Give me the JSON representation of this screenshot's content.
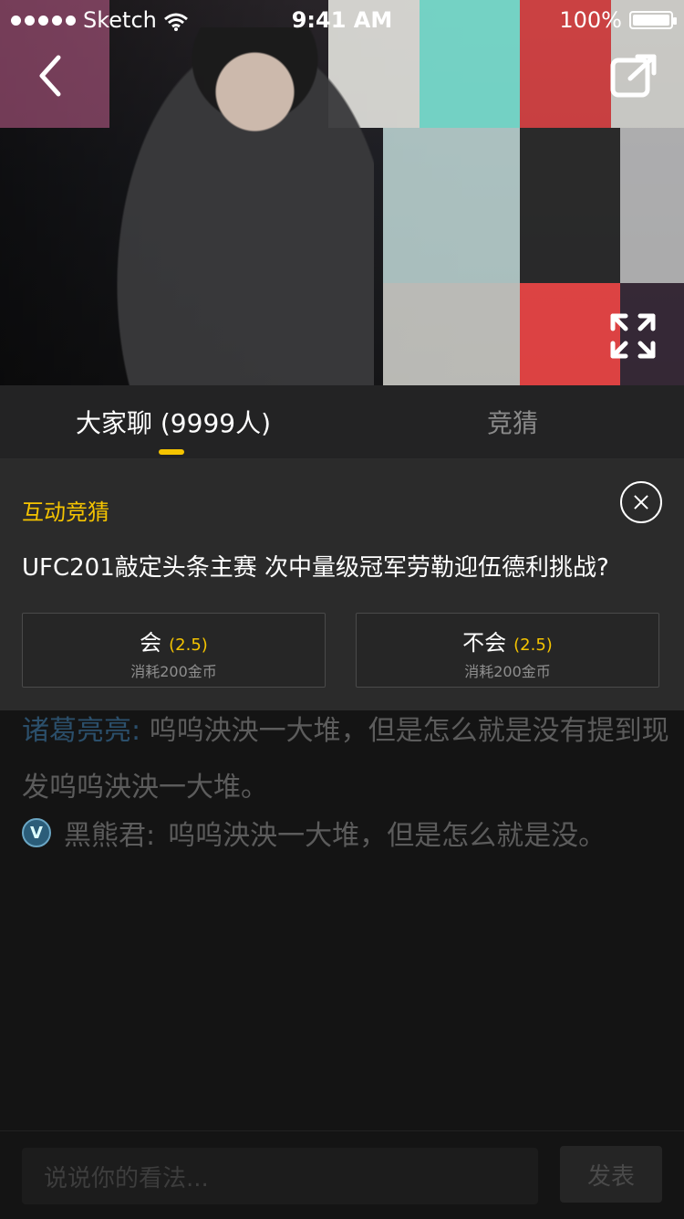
{
  "status_bar": {
    "carrier": "Sketch",
    "time": "9:41 AM",
    "battery": "100%"
  },
  "video": {
    "back_icon": "chevron-left-icon",
    "share_icon": "share-icon",
    "fullscreen_icon": "fullscreen-icon"
  },
  "tabs": [
    {
      "label": "大家聊 (9999人)"
    },
    {
      "label": "竞猜"
    }
  ],
  "quiz": {
    "title": "互动竞猜",
    "question": "UFC201敲定头条主赛 次中量级冠军劳勒迎伍德利挑战?",
    "options": [
      {
        "label": "会",
        "odds": "(2.5)",
        "cost": "消耗200金币"
      },
      {
        "label": "不会",
        "odds": "(2.5)",
        "cost": "消耗200金币"
      }
    ]
  },
  "chat": {
    "message1_name": "诸葛亮亮:",
    "message1_text": "呜呜泱泱一大堆，但是怎么就是没有提到现发呜呜泱泱一大堆。",
    "message2_badge": "V",
    "message2_name": "黑熊君:",
    "message2_text": "呜呜泱泱一大堆，但是怎么就是没。"
  },
  "composer": {
    "placeholder": "说说你的看法...",
    "send_label": "发表"
  },
  "colors": {
    "accent": "#f5c400"
  }
}
